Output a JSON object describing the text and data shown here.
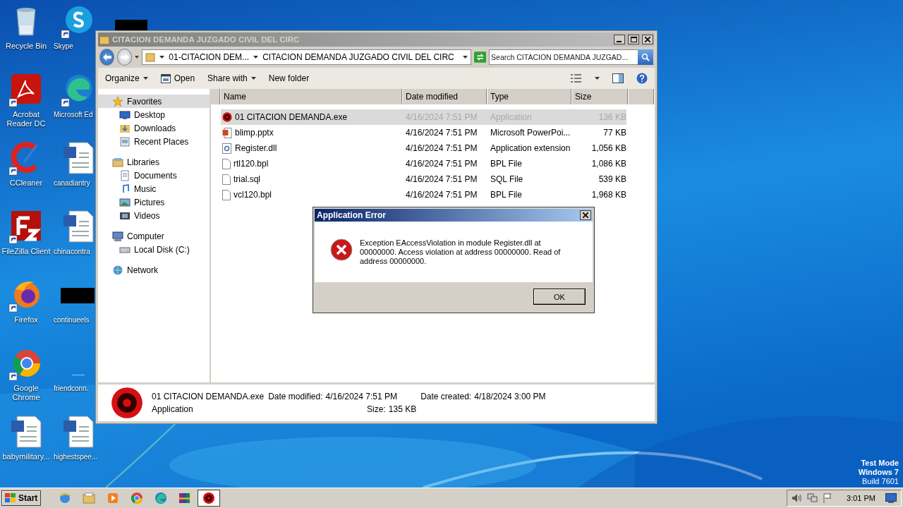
{
  "desktop_icons": [
    {
      "label": "Recycle Bin",
      "kind": "recycle",
      "shortcut": false
    },
    {
      "label": "Skype",
      "kind": "skype",
      "shortcut": true
    },
    {
      "label": "Acrobat Reader DC",
      "kind": "acrobat",
      "shortcut": true
    },
    {
      "label": "Microsoft Ed",
      "kind": "edge",
      "shortcut": true
    },
    {
      "label": "CCleaner",
      "kind": "ccleaner",
      "shortcut": true
    },
    {
      "label": "canadiantry",
      "kind": "word",
      "shortcut": false
    },
    {
      "label": "FileZilla Client",
      "kind": "filezilla",
      "shortcut": true
    },
    {
      "label": "chinacontra",
      "kind": "word",
      "shortcut": false
    },
    {
      "label": "Firefox",
      "kind": "firefox",
      "shortcut": true
    },
    {
      "label": "continueels",
      "kind": "redacted",
      "shortcut": false
    },
    {
      "label": "Google Chrome",
      "kind": "chrome",
      "shortcut": true
    },
    {
      "label": "friendconn.",
      "kind": "blank",
      "shortcut": false
    },
    {
      "label": "babymilitary...",
      "kind": "word",
      "shortcut": false
    },
    {
      "label": "highestspee...",
      "kind": "word",
      "shortcut": false
    }
  ],
  "os_info": [
    "Test Mode",
    "Windows 7",
    "Build 7601"
  ],
  "explorer": {
    "title": "CITACION DEMANDA JUZGADO CIVIL DEL CIRC",
    "breadcrumb": [
      "01-CITACION DEM...",
      "CITACION DEMANDA JUZGADO CIVIL DEL CIRC"
    ],
    "search": {
      "placeholder": "Search CITACION DEMANDA JUZGAD..."
    },
    "toolbar": [
      {
        "label": "Organize",
        "kind": "menu"
      },
      {
        "label": "Open",
        "kind": "open"
      },
      {
        "label": "Share with",
        "kind": "menu"
      },
      {
        "label": "New folder",
        "kind": "plain"
      }
    ],
    "nav": [
      {
        "label": "Favorites",
        "kind": "star",
        "selected": true,
        "children": [
          {
            "label": "Desktop",
            "kind": "desktop",
            "selected": false
          },
          {
            "label": "Downloads",
            "kind": "downloads",
            "selected": false
          },
          {
            "label": "Recent Places",
            "kind": "recent",
            "selected": false
          }
        ]
      },
      {
        "label": "Libraries",
        "kind": "library",
        "selected": false,
        "children": [
          {
            "label": "Documents",
            "kind": "documents",
            "selected": false
          },
          {
            "label": "Music",
            "kind": "music",
            "selected": false
          },
          {
            "label": "Pictures",
            "kind": "pictures",
            "selected": false
          },
          {
            "label": "Videos",
            "kind": "videos",
            "selected": false
          }
        ]
      },
      {
        "label": "Computer",
        "kind": "computer",
        "selected": false,
        "children": [
          {
            "label": "Local Disk (C:)",
            "kind": "disk",
            "selected": false
          }
        ]
      },
      {
        "label": "Network",
        "kind": "network",
        "selected": false
      }
    ],
    "columns": [
      "Name",
      "Date modified",
      "Type",
      "Size"
    ],
    "files": [
      {
        "name": "01 CITACION DEMANDA.exe",
        "date": "4/16/2024 7:51 PM",
        "type": "Application",
        "size": "136 KB",
        "kind": "exe",
        "selected": true
      },
      {
        "name": "blimp.pptx",
        "date": "4/16/2024 7:51 PM",
        "type": "Microsoft PowerPoi...",
        "size": "77 KB",
        "kind": "pptx",
        "selected": false
      },
      {
        "name": "Register.dll",
        "date": "4/16/2024 7:51 PM",
        "type": "Application extension",
        "size": "1,056 KB",
        "kind": "dll",
        "selected": false
      },
      {
        "name": "rtl120.bpl",
        "date": "4/16/2024 7:51 PM",
        "type": "BPL File",
        "size": "1,086 KB",
        "kind": "blank",
        "selected": false
      },
      {
        "name": "trial.sql",
        "date": "4/16/2024 7:51 PM",
        "type": "SQL File",
        "size": "539 KB",
        "kind": "blank",
        "selected": false
      },
      {
        "name": "vcl120.bpl",
        "date": "4/16/2024 7:51 PM",
        "type": "BPL File",
        "size": "1,968 KB",
        "kind": "blank",
        "selected": false
      }
    ],
    "details": {
      "name": "01 CITACION DEMANDA.exe",
      "type": "Application",
      "modified_label": "Date modified:",
      "modified": "4/16/2024 7:51 PM",
      "created_label": "Date created:",
      "created": "4/18/2024 3:00 PM",
      "size_label": "Size:",
      "size": "135 KB"
    }
  },
  "dialog": {
    "title": "Application Error",
    "message": "Exception EAccessViolation in module Register.dll at 00000000. Access violation at address 00000000. Read of address 00000000.",
    "button": "OK"
  },
  "taskbar": {
    "start": "Start",
    "apps": [
      {
        "kind": "ie",
        "active": false
      },
      {
        "kind": "folder",
        "active": false
      },
      {
        "kind": "media",
        "active": false
      },
      {
        "kind": "chrome",
        "active": false
      },
      {
        "kind": "edge",
        "active": false
      },
      {
        "kind": "winrar",
        "active": false
      },
      {
        "kind": "exe",
        "active": true
      }
    ],
    "clock": "3:01 PM"
  }
}
